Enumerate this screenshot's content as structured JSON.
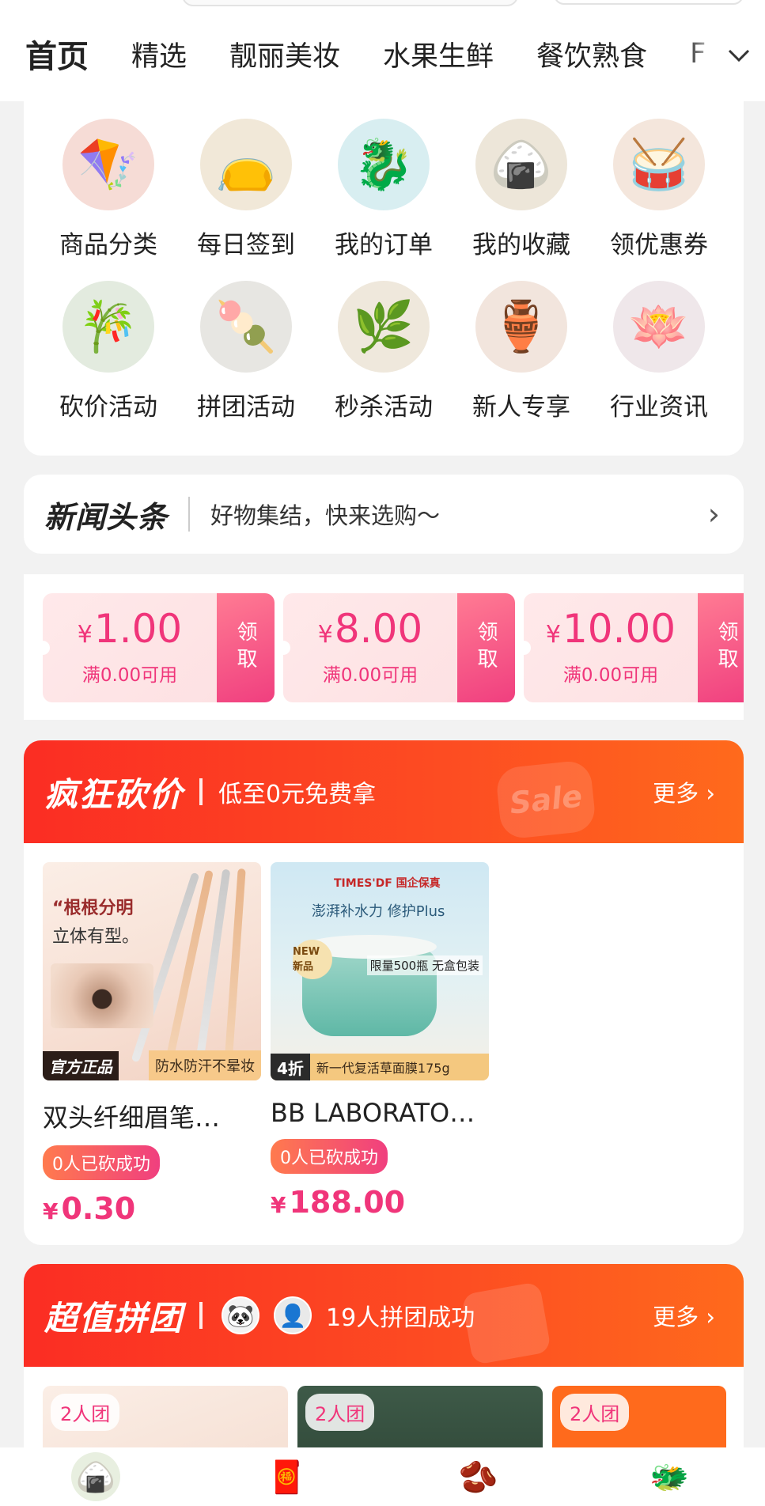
{
  "tabs": {
    "items": [
      "首页",
      "精选",
      "靓丽美妆",
      "水果生鲜",
      "餐饮熟食",
      "F"
    ],
    "more_icon": "chevron-down-icon"
  },
  "grid": {
    "items": [
      {
        "label": "商品分类",
        "icon": "kite-icon",
        "emoji": "🪁",
        "bg": "#f6dcd6"
      },
      {
        "label": "每日签到",
        "icon": "pouch-icon",
        "emoji": "👝",
        "bg": "#f1e8d8"
      },
      {
        "label": "我的订单",
        "icon": "dragon-boat-icon",
        "emoji": "🐉",
        "bg": "#d8eef1"
      },
      {
        "label": "我的收藏",
        "icon": "zongzi-icon",
        "emoji": "🍙",
        "bg": "#ede6d9"
      },
      {
        "label": "领优惠券",
        "icon": "drum-icon",
        "emoji": "🥁",
        "bg": "#f4e6dc"
      },
      {
        "label": "砍价活动",
        "icon": "bamboo-icon",
        "emoji": "🎋",
        "bg": "#e3ebdf"
      },
      {
        "label": "拼团活动",
        "icon": "qingtuan-icon",
        "emoji": "🍡",
        "bg": "#e7e6e2"
      },
      {
        "label": "秒杀活动",
        "icon": "mugwort-icon",
        "emoji": "🌿",
        "bg": "#efe8dc"
      },
      {
        "label": "新人专享",
        "icon": "wine-jar-icon",
        "emoji": "🏺",
        "bg": "#f2e5dd"
      },
      {
        "label": "行业资讯",
        "icon": "lotus-icon",
        "emoji": "🪷",
        "bg": "#efe7ea"
      }
    ]
  },
  "news": {
    "logo": "新闻头条",
    "text": "好物集结，快来选购～",
    "arrow": "›"
  },
  "coupons": [
    {
      "currency": "¥",
      "amount": "1.00",
      "condition": "满0.00可用",
      "action": "领取"
    },
    {
      "currency": "¥",
      "amount": "8.00",
      "condition": "满0.00可用",
      "action": "领取"
    },
    {
      "currency": "¥",
      "amount": "10.00",
      "condition": "满0.00可用",
      "action": "领取"
    }
  ],
  "bargain": {
    "title": "疯狂砍价",
    "subtitle": "低至0元免费拿",
    "more": "更多 ›",
    "badge": "Sale",
    "products": [
      {
        "name": "双头纤细眉笔…",
        "pill": "0人已砍成功",
        "currency": "¥",
        "price": "0.30",
        "img_a": "“根根分明",
        "img_b": "立体有型。",
        "tag_left": "官方正品",
        "tag_right": "防水防汗不晕妆"
      },
      {
        "name": "BB LABORATO…",
        "pill": "0人已砍成功",
        "currency": "¥",
        "price": "188.00",
        "brand": "TIMES'DF 国企保真",
        "slogan": "澎湃补水力  修护Plus",
        "new_tag": "NEW 新品",
        "limit": "限量500瓶 无盒包装",
        "discount": "4折",
        "bottom": "新一代复活草面膜175g"
      }
    ]
  },
  "group": {
    "title": "超值拼团",
    "success_text": "19人拼团成功",
    "more": "更多 ›",
    "pills": [
      "2人团",
      "2人团",
      "2人团"
    ]
  },
  "bottom_nav": {
    "items": [
      {
        "icon": "zongzi-nav-icon",
        "emoji": "🍙",
        "bg": "#e8efe0"
      },
      {
        "icon": "pouch-nav-icon",
        "emoji": "🧧",
        "bg": "#fff"
      },
      {
        "icon": "beans-nav-icon",
        "emoji": "🫘",
        "bg": "#fff"
      },
      {
        "icon": "dragon-nav-icon",
        "emoji": "🐲",
        "bg": "#fff"
      }
    ]
  }
}
